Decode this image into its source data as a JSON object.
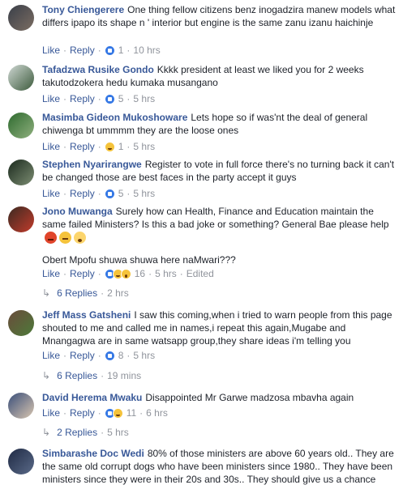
{
  "labels": {
    "like": "Like",
    "reply": "Reply",
    "sep": "·"
  },
  "comments": [
    {
      "author": "Tony Chiengerere",
      "text": "One thing fellow citizens benz inogadzira manew models what differs ipapo its shape n ' interior but engine is the same zanu izanu haichinje",
      "reactions": [
        "like"
      ],
      "count": "1",
      "time": "10 hrs",
      "avatar_colors": [
        "#3a3f49",
        "#7b6d62"
      ]
    },
    {
      "author": "Tafadzwa Rusike Gondo",
      "text": "Kkkk president at least we liked you for 2 weeks takutodzokera hedu kumaka musangano",
      "reactions": [
        "like"
      ],
      "count": "5",
      "time": "5 hrs",
      "avatar_colors": [
        "#cfd8d3",
        "#3c5a3c"
      ]
    },
    {
      "author": "Masimba Gideon Mukoshoware",
      "text": "Lets hope so if was'nt the deal of general chiwenga bt ummmm they are the loose ones",
      "reactions": [
        "haha"
      ],
      "count": "1",
      "time": "5 hrs",
      "avatar_colors": [
        "#2e6a2f",
        "#8fb07e"
      ]
    },
    {
      "author": "Stephen Nyarirangwe",
      "text": "Register to vote in full force there's no turning back it can't be changed those are best faces in the party accept it guys",
      "reactions": [
        "like"
      ],
      "count": "5",
      "time": "5 hrs",
      "avatar_colors": [
        "#1b2a1e",
        "#7c8d72"
      ]
    },
    {
      "author": "Jono Muwanga",
      "text": "Surely how can Health, Finance and Education maintain the same failed Ministers? Is this a bad joke or something? General Bae please help",
      "text2": "Obert Mpofu shuwa shuwa here naMwari???",
      "emojis": [
        "angry",
        "confounded",
        "dizzy"
      ],
      "reactions": [
        "like",
        "haha",
        "wow"
      ],
      "count": "16",
      "time": "5 hrs",
      "edited": "Edited",
      "replies": "6 Replies",
      "replies_time": "2 hrs",
      "avatar_colors": [
        "#3b2a22",
        "#c23b2b"
      ]
    },
    {
      "author": "Jeff Mass Gatsheni",
      "text": "I saw this coming,when i tried to warn people from this page shouted to me and called me in names,i repeat this again,Mugabe and Mnangagwa are in same watsapp group,they share ideas i'm telling you",
      "reactions": [
        "like"
      ],
      "count": "8",
      "time": "5 hrs",
      "replies": "6 Replies",
      "replies_time": "19 mins",
      "avatar_colors": [
        "#6a4b3b",
        "#4d7a3a"
      ]
    },
    {
      "author": "David Herema Mwaku",
      "text": "Disappointed Mr Garwe madzosa mbavha again",
      "reactions": [
        "like",
        "haha"
      ],
      "count": "11",
      "time": "6 hrs",
      "replies": "2 Replies",
      "replies_time": "5 hrs",
      "avatar_colors": [
        "#3a4f7a",
        "#d9c6b0"
      ]
    },
    {
      "author": "Simbarashe Doc Wedi",
      "text": "80% of those ministers are above 60 years old.. They are the same old corrupt dogs who have been ministers since 1980.. They have been ministers since they were in their 20s and 30s.. They should give us a chance",
      "avatar_colors": [
        "#1f2a44",
        "#5a6a88"
      ]
    }
  ]
}
